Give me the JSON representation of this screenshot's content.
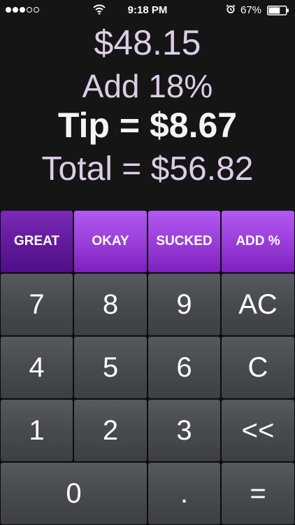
{
  "status_bar": {
    "time": "9:18 PM",
    "battery": "67%",
    "battery_level": 0.67,
    "signal_bars_filled": 3,
    "signal_bars_total": 5,
    "icons": [
      "signal-dots",
      "wifi-icon",
      "alarm-icon",
      "battery-icon"
    ]
  },
  "display": {
    "bill": "$48.15",
    "percent": "Add 18%",
    "tip": "Tip = $8.67",
    "total": "Total = $56.82"
  },
  "rating": {
    "great": "GREAT",
    "okay": "OKAY",
    "sucked": "SUCKED",
    "add_percent": "ADD %",
    "selected": "great"
  },
  "keys": {
    "k7": "7",
    "k8": "8",
    "k9": "9",
    "ac": "AC",
    "k4": "4",
    "k5": "5",
    "k6": "6",
    "c": "C",
    "k1": "1",
    "k2": "2",
    "k3": "3",
    "backspace": "<<",
    "k0": "0",
    "dot": ".",
    "equals": "="
  },
  "colors": {
    "display_text": "#dccde6",
    "tip_text": "#f4f4f4",
    "purple_button": "#9b3fdb",
    "purple_selected": "#631a9e",
    "gray_key": "#474a4f",
    "background": "#151516"
  }
}
